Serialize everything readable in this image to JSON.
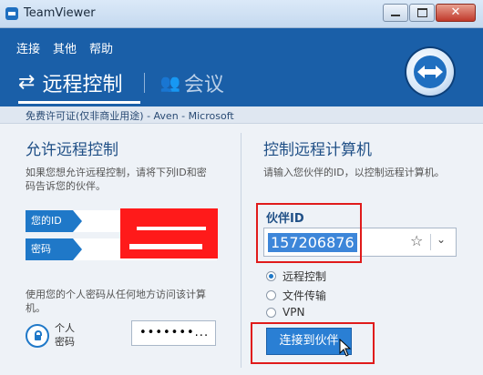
{
  "window": {
    "title": "TeamViewer"
  },
  "menu": [
    "连接",
    "其他",
    "帮助"
  ],
  "nav": {
    "active_label": "远程控制",
    "inactive_label": "会议"
  },
  "license": "免费许可证(仅非商业用途) - Aven - Microsoft",
  "left": {
    "title": "允许远程控制",
    "desc_line1": "如果您想允许远程控制，请将下列ID和密",
    "desc_line2": "码告诉您的伙伴。",
    "id_label": "您的ID",
    "id_value": "",
    "password_label": "密码",
    "password_value": "",
    "personal_desc_line1": "使用您的个人密码从任何地方访问该计算",
    "personal_desc_line2": "机。",
    "personal_label_line1": "个人",
    "personal_label_line2": "密码",
    "personal_password": "•••••••..."
  },
  "right": {
    "title": "控制远程计算机",
    "desc": "请输入您伙伴的ID，以控制远程计算机。",
    "partner_id_label": "伙伴ID",
    "partner_id_value": "157206876",
    "options": [
      {
        "label": "远程控制",
        "checked": true
      },
      {
        "label": "文件传输",
        "checked": false
      },
      {
        "label": "VPN",
        "checked": false
      }
    ],
    "connect_label": "连接到伙伴"
  },
  "colors": {
    "header_blue": "#1a5fa8",
    "button_blue": "#2a7fd4",
    "highlight_red": "#e01b1b"
  }
}
